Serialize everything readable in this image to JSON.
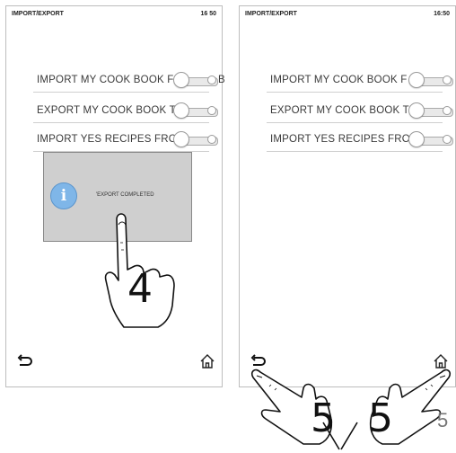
{
  "left_screen": {
    "title": "IMPORT/EXPORT",
    "clock": "16 50",
    "rows": [
      {
        "label": "IMPORT MY COOK BOOK F",
        "trailing": "B"
      },
      {
        "label": "EXPORT MY COOK BOOK T"
      },
      {
        "label": "IMPORT YES RECIPES FRO"
      }
    ],
    "popup": {
      "icon": "info-icon",
      "icon_glyph": "i",
      "message": "'EXPORT COMPLETED"
    },
    "step": "4",
    "back_icon": "back-arrow-icon",
    "home_icon": "home-icon"
  },
  "right_screen": {
    "title": "IMPORT/EXPORT",
    "clock": "16:50",
    "rows": [
      {
        "label": "IMPORT MY COOK BOOK F"
      },
      {
        "label": "EXPORT MY COOK BOOK T"
      },
      {
        "label": "IMPORT YES RECIPES FRO"
      }
    ],
    "step_left": "5",
    "step_right": "5",
    "back_icon": "back-arrow-icon",
    "home_icon": "home-icon"
  },
  "page_number": "5"
}
